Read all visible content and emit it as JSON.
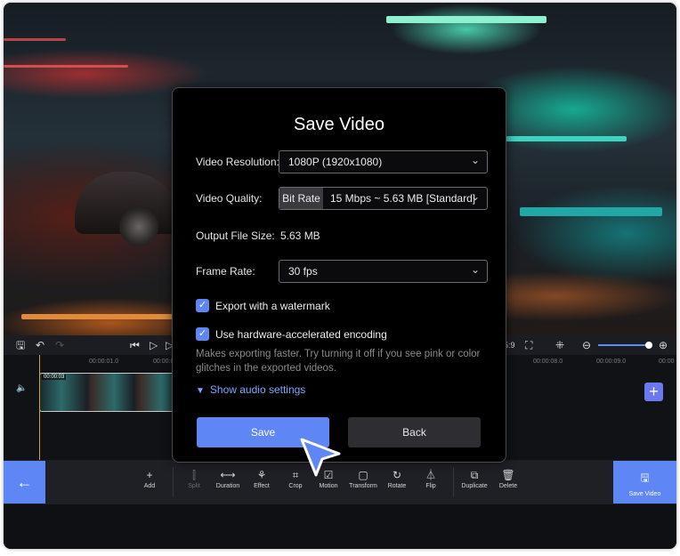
{
  "timeline": {
    "clip_label": "00:00:03",
    "ruler_marks": [
      "00:00:01.0",
      "00:00:0",
      "00:00:08.0",
      "00:00:09.0",
      "00:00"
    ],
    "time_partial": "5:9"
  },
  "toolbar": {
    "add": "Add",
    "split": "Split",
    "duration": "Duration",
    "effect": "Effect",
    "crop": "Crop",
    "motion": "Motion",
    "transform": "Transform",
    "rotate": "Rotate",
    "flip": "Flip",
    "duplicate": "Duplicate",
    "delete": "Delete",
    "save_video": "Save Video"
  },
  "dialog": {
    "title": "Save Video",
    "resolution_label": "Video Resolution:",
    "resolution_value": "1080P (1920x1080)",
    "quality_label": "Video Quality:",
    "quality_mode": "Bit Rate",
    "quality_value": "15 Mbps ~ 5.63 MB [Standard]",
    "filesize_label": "Output File Size:",
    "filesize_value": "5.63 MB",
    "framerate_label": "Frame Rate:",
    "framerate_value": "30 fps",
    "watermark_label": "Export with a watermark",
    "watermark_checked": true,
    "hwaccel_label": "Use hardware-accelerated encoding",
    "hwaccel_checked": true,
    "hwaccel_hint": "Makes exporting faster. Try turning it off if you see pink or color glitches in the exported videos.",
    "audio_settings_link": "Show audio settings",
    "save_button": "Save",
    "back_button": "Back"
  },
  "colors": {
    "accent": "#5e86f5",
    "dialog_bg": "#000000",
    "link": "#7fa6ff"
  },
  "icons": {
    "check": "✓",
    "chevron": "⌄"
  }
}
